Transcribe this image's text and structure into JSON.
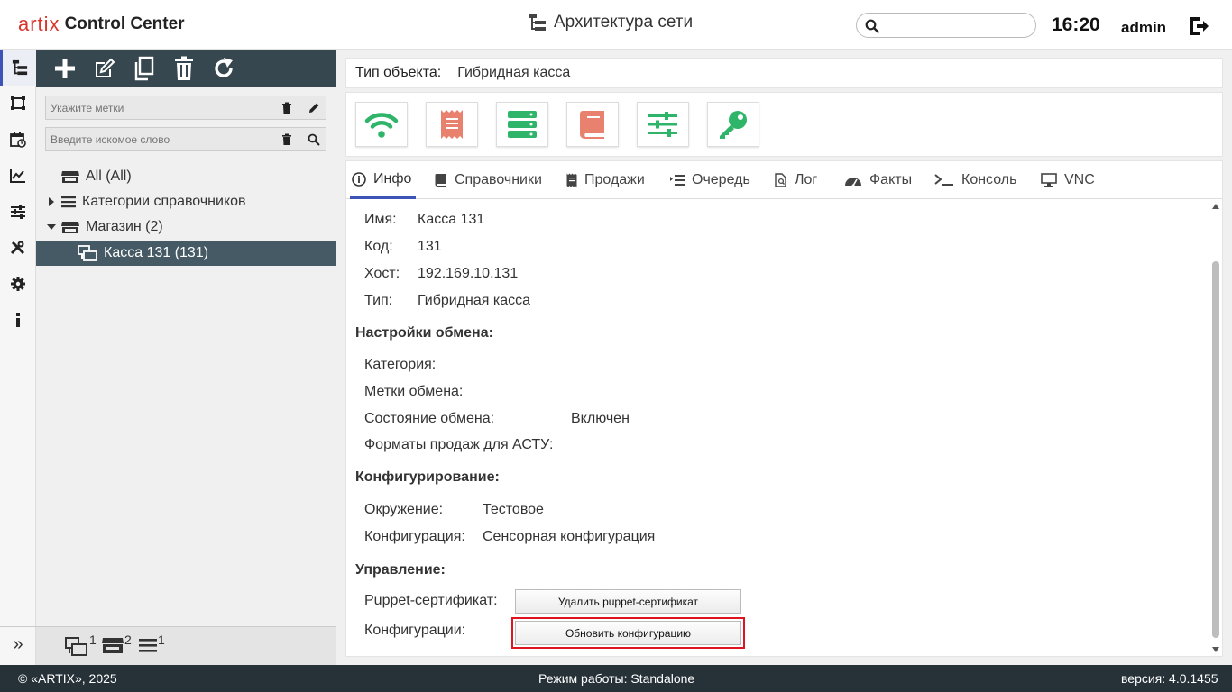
{
  "header": {
    "logo_brand": "artix",
    "logo_product": "Control Center",
    "page_title": "Архитектура сети",
    "search_placeholder": "",
    "time": "16:20",
    "user": "admin"
  },
  "toolbar": {
    "buttons": [
      "add-icon",
      "edit-icon",
      "copy-icon",
      "delete-icon",
      "refresh-icon"
    ]
  },
  "filters": {
    "tags_placeholder": "Укажите метки",
    "search_placeholder": "Введите искомое слово"
  },
  "tree": {
    "items": [
      {
        "label": "All (All)"
      },
      {
        "label": "Категории справочников"
      },
      {
        "label": "Магазин (2)"
      },
      {
        "label": "Касса 131 (131)"
      }
    ]
  },
  "tree_footer": {
    "pos_count": "1",
    "store_count": "2",
    "category_count": "1"
  },
  "object": {
    "type_label": "Тип объекта:",
    "type_value": "Гибридная касса"
  },
  "tabs": [
    {
      "label": "Инфо"
    },
    {
      "label": "Справочники"
    },
    {
      "label": "Продажи"
    },
    {
      "label": "Очередь"
    },
    {
      "label": "Лог"
    },
    {
      "label": "Факты"
    },
    {
      "label": "Консоль"
    },
    {
      "label": "VNC"
    }
  ],
  "info": {
    "name_label": "Имя:",
    "name_value": "Касса 131",
    "code_label": "Код:",
    "code_value": "131",
    "host_label": "Хост:",
    "host_value": "192.169.10.131",
    "type_label": "Тип:",
    "type_value": "Гибридная касса",
    "exchange_title": "Настройки обмена:",
    "category_label": "Категория:",
    "tags_label": "Метки обмена:",
    "state_label": "Состояние обмена:",
    "state_value": "Включен",
    "formats_label": "Форматы продаж для АСТУ:",
    "config_title": "Конфигурирование:",
    "env_label": "Окружение:",
    "env_value": "Тестовое",
    "conf_label": "Конфигурация:",
    "conf_value": "Сенсорная конфигурация",
    "mgmt_title": "Управление:",
    "puppet_label": "Puppet-сертификат:",
    "puppet_button": "Удалить puppet-сертификат",
    "configs_label": "Конфигурации:",
    "configs_button": "Обновить конфигурацию"
  },
  "statusbar": {
    "copyright": "© «ARTIX», 2025",
    "mode": "Режим работы: Standalone",
    "version": "версия: 4.0.1455"
  },
  "colors": {
    "accent": "#3d53b5",
    "brand_red": "#d9352b",
    "toolbar_bg": "#37474f",
    "selected_row": "#455a64",
    "statusbar_bg": "#263238",
    "green_icon": "#2fb56a",
    "salmon_icon": "#e8826f",
    "highlight": "#e0141e"
  }
}
